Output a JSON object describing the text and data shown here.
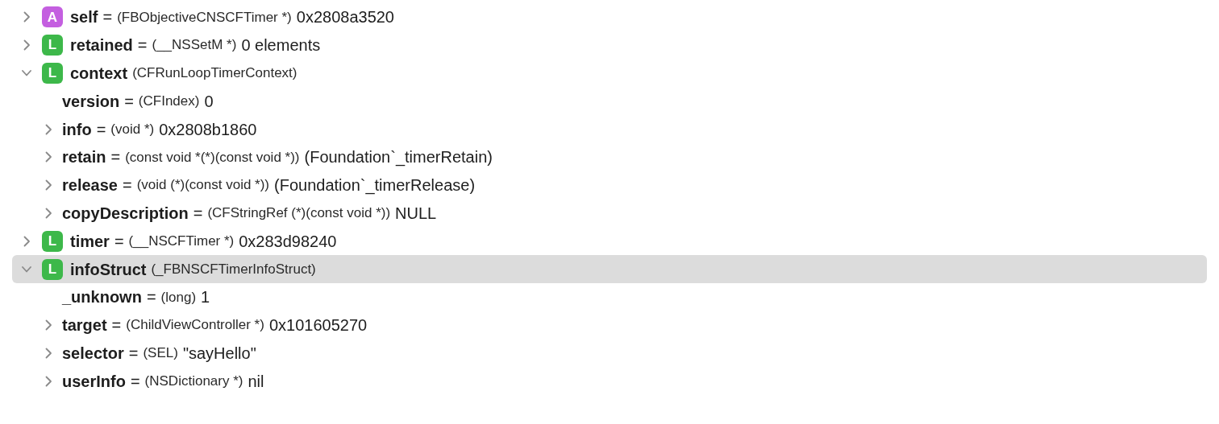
{
  "variables": [
    {
      "name": "self",
      "operator": "=",
      "type": "(FBObjectiveCNSCFTimer *)",
      "value": "0x2808a3520",
      "badge": "A",
      "color": "#c45fe0",
      "expanded": false,
      "selected": false
    },
    {
      "name": "retained",
      "operator": "=",
      "type": "(__NSSetM *)",
      "value": "0 elements",
      "badge": "L",
      "color": "#3db84a",
      "expanded": false,
      "selected": false
    },
    {
      "name": "context",
      "type": "(CFRunLoopTimerContext)",
      "badge": "L",
      "color": "#3db84a",
      "expanded": true,
      "selected": false,
      "children": [
        {
          "name": "version",
          "operator": "=",
          "type": "(CFIndex)",
          "value": "0",
          "selected": false
        },
        {
          "name": "info",
          "operator": "=",
          "type": "(void *)",
          "value": "0x2808b1860",
          "expanded": false,
          "selected": false
        },
        {
          "name": "retain",
          "operator": "=",
          "type": "(const void *(*)(const void *))",
          "value": "(Foundation`_timerRetain)",
          "expanded": false,
          "selected": false
        },
        {
          "name": "release",
          "operator": "=",
          "type": "(void (*)(const void *))",
          "value": "(Foundation`_timerRelease)",
          "expanded": false,
          "selected": false
        },
        {
          "name": "copyDescription",
          "operator": "=",
          "type": "(CFStringRef (*)(const void *))",
          "value": "NULL",
          "expanded": false,
          "selected": false
        }
      ]
    },
    {
      "name": "timer",
      "operator": "=",
      "type": "(__NSCFTimer *)",
      "value": "0x283d98240",
      "badge": "L",
      "color": "#3db84a",
      "expanded": false,
      "selected": false
    },
    {
      "name": "infoStruct",
      "type": "(_FBNSCFTimerInfoStruct)",
      "badge": "L",
      "color": "#3db84a",
      "expanded": true,
      "selected": true,
      "children": [
        {
          "name": "_unknown",
          "operator": "=",
          "type": "(long)",
          "value": "1",
          "selected": false
        },
        {
          "name": "target",
          "operator": "=",
          "type": "(ChildViewController *)",
          "value": "0x101605270",
          "expanded": false,
          "selected": false
        },
        {
          "name": "selector",
          "operator": "=",
          "type": "(SEL)",
          "value": "\"sayHello\"",
          "expanded": false,
          "selected": false
        },
        {
          "name": "userInfo",
          "operator": "=",
          "type": "(NSDictionary *)",
          "value": "nil",
          "expanded": false,
          "selected": false
        }
      ]
    }
  ]
}
